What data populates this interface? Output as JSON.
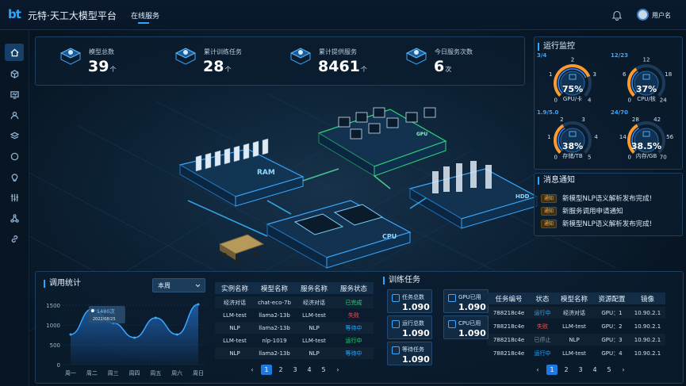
{
  "app": {
    "logo": "bt",
    "title": "元特·天工大模型平台",
    "nav_tab": "在线服务",
    "user": "用户名"
  },
  "colors": {
    "accent": "#2aa8ff",
    "warn": "#f4b24a",
    "danger": "#ff4d4f",
    "success": "#2ed47a"
  },
  "sidebar": {
    "items": [
      "home-icon",
      "cube-icon",
      "monitor-icon",
      "user-icon",
      "layers-icon",
      "chat-icon",
      "bulb-icon",
      "sliders-icon",
      "network-icon",
      "link-icon"
    ]
  },
  "stats": [
    {
      "label": "模型总数",
      "value": "39",
      "unit": "个"
    },
    {
      "label": "累计训练任务",
      "value": "28",
      "unit": "个"
    },
    {
      "label": "累计提供服务",
      "value": "8461",
      "unit": "个"
    },
    {
      "label": "今日服务次数",
      "value": "6",
      "unit": "次"
    }
  ],
  "scene": {
    "labels": {
      "ram": "RAM",
      "gpu": "GPU",
      "cpu": "CPU",
      "hdd": "HDD"
    }
  },
  "monitor": {
    "title": "运行监控",
    "gauges": [
      {
        "ratio": "3/4",
        "percent": "75%",
        "sub": "GPU/卡",
        "ticks": [
          "0",
          "1",
          "2",
          "3",
          "4"
        ],
        "level": 75
      },
      {
        "ratio": "12/23",
        "percent": "37%",
        "sub": "CPU/核",
        "ticks": [
          "0",
          "6",
          "12",
          "18",
          "24"
        ],
        "level": 37
      },
      {
        "ratio": "1.9/5.0",
        "percent": "38%",
        "sub": "存储/TB",
        "ticks": [
          "0",
          "1",
          "2",
          "3",
          "4",
          "5"
        ],
        "level": 38
      },
      {
        "ratio": "24/70",
        "percent": "38.5%",
        "sub": "内存/GB",
        "ticks": [
          "0",
          "14",
          "28",
          "42",
          "56",
          "70"
        ],
        "level": 38.5
      }
    ]
  },
  "notices": {
    "title": "消息通知",
    "badge": "通知",
    "items": [
      "新模型NLP语义解析发布完成!",
      "新服务调用申请通知",
      "新模型NLP语义解析发布完成!"
    ]
  },
  "usage": {
    "title": "调用统计",
    "period": "本周",
    "tooltip_value": "1480次",
    "tooltip_date": "2022/08/25",
    "chart_data": {
      "type": "area",
      "categories": [
        "周一",
        "周二",
        "周三",
        "周四",
        "周五",
        "周六",
        "周日"
      ],
      "values": [
        760,
        1400,
        1050,
        680,
        1180,
        760,
        1520
      ],
      "yticks": [
        "1500",
        "1000",
        "500",
        "0"
      ],
      "ylim": [
        0,
        1600
      ],
      "grid": true
    }
  },
  "instances": {
    "headers": [
      "实例名称",
      "模型名称",
      "服务名称",
      "服务状态"
    ],
    "rows": [
      [
        "经济对话",
        "chat-eco-7b",
        "经济对话",
        "已完成",
        "#2ed47a"
      ],
      [
        "LLM-test",
        "llama2-13b",
        "LLM-test",
        "失败",
        "#ff4d4f"
      ],
      [
        "NLP",
        "llama2-13b",
        "NLP",
        "等待中",
        "#2aa8ff"
      ],
      [
        "LLM-test",
        "nlp-1019",
        "LLM-test",
        "运行中",
        "#2ed47a"
      ],
      [
        "NLP",
        "llama2-13b",
        "NLP",
        "等待中",
        "#2aa8ff"
      ]
    ],
    "pages": [
      "1",
      "2",
      "3",
      "4",
      "5"
    ]
  },
  "training": {
    "title": "训练任务",
    "cards": [
      {
        "label": "任务总数",
        "value": "1.090"
      },
      {
        "label": "GPU已用",
        "value": "1.090"
      },
      {
        "label": "运行总数",
        "value": "1.090"
      },
      {
        "label": "CPU已用",
        "value": "1.090"
      },
      {
        "label": "等待任务",
        "value": "1.090"
      }
    ],
    "headers": [
      "任务编号",
      "状态",
      "模型名称",
      "资源配置",
      "镜像"
    ],
    "rows": [
      [
        "788218c4e",
        "运行中",
        "经济对话",
        "GPU：1",
        "10.90.2.1",
        "#2aa8ff"
      ],
      [
        "788218c4e",
        "失败",
        "LLM-test",
        "GPU：2",
        "10.90.2.1",
        "#ff4d4f"
      ],
      [
        "788218c4e",
        "已停止",
        "NLP",
        "GPU：3",
        "10.90.2.1",
        "#7f93a7"
      ],
      [
        "788218c4e",
        "运行中",
        "LLM-test",
        "GPU：4",
        "10.90.2.1",
        "#2aa8ff"
      ]
    ],
    "pages": [
      "1",
      "2",
      "3",
      "4",
      "5"
    ]
  },
  "pager_prev": "‹",
  "pager_next": "›"
}
